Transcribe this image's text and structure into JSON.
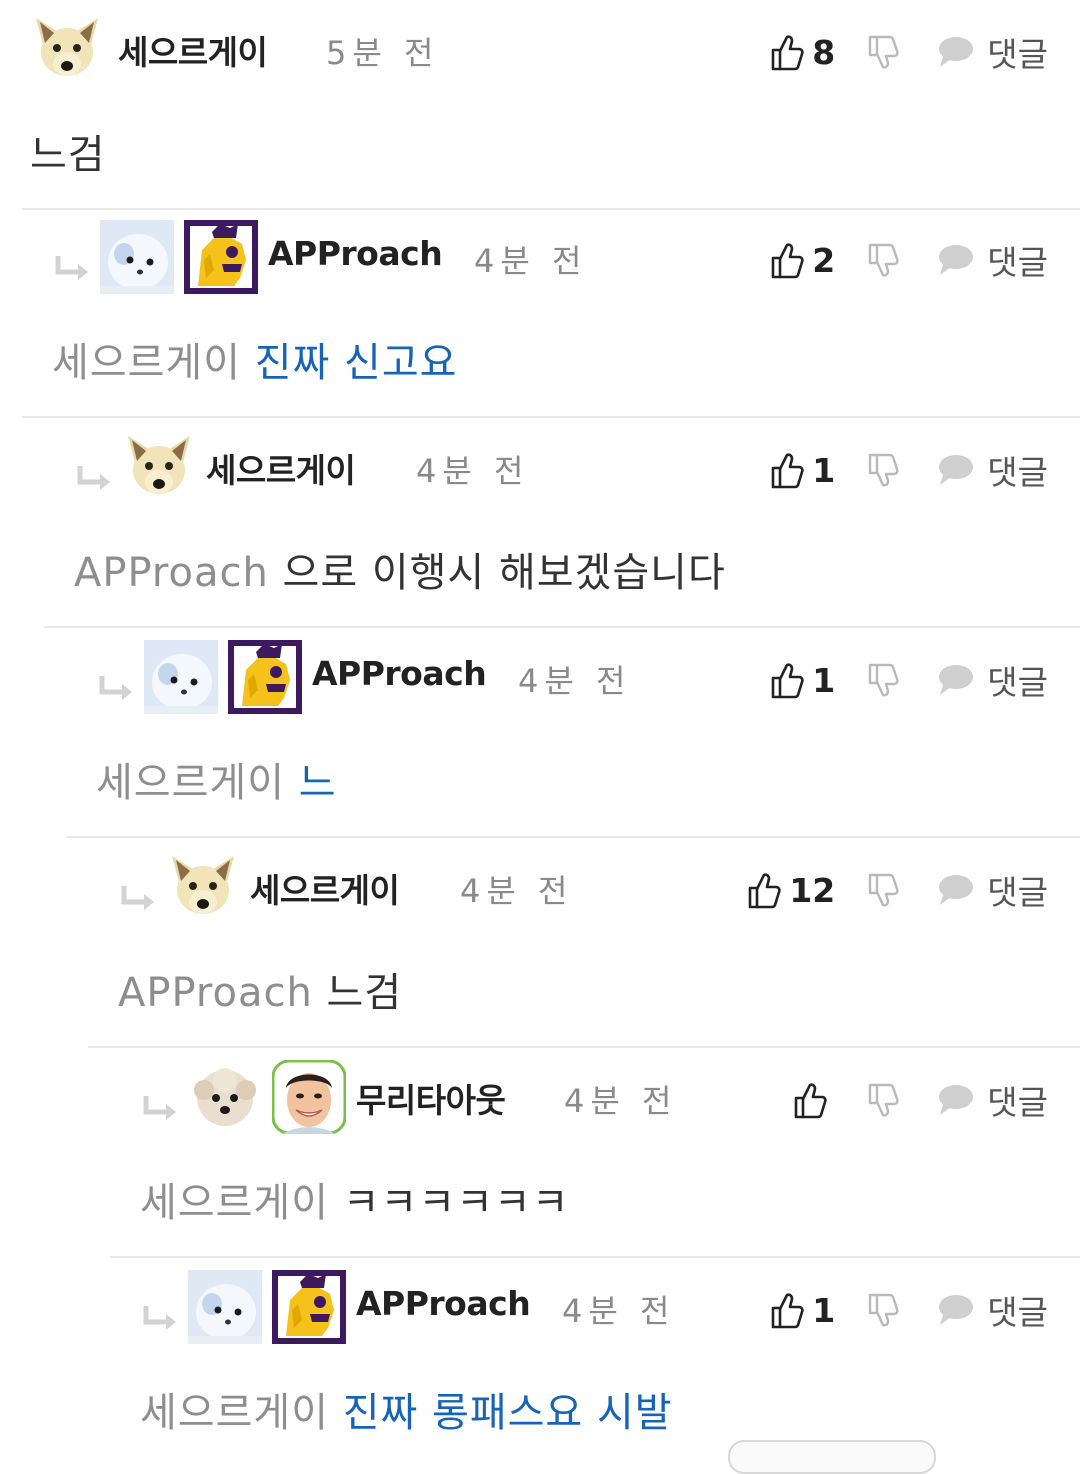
{
  "reply_label": "댓글",
  "comments": [
    {
      "user": "세으르게이",
      "time": "5분 전",
      "likes": "8",
      "mention": "",
      "text": "느검",
      "avatar": "dog-avatar"
    },
    {
      "user": "APProach",
      "time": "4분 전",
      "likes": "2",
      "mention": "세으르게이",
      "text": "진짜 신고요",
      "avatar": "seal-avatar",
      "badge": "premier-league-badge"
    },
    {
      "user": "세으르게이",
      "time": "4분 전",
      "likes": "1",
      "mention": "APProach",
      "text": "으로 이행시 해보겠습니다",
      "avatar": "dog-avatar"
    },
    {
      "user": "APProach",
      "time": "4분 전",
      "likes": "1",
      "mention": "세으르게이",
      "text": "느",
      "avatar": "seal-avatar",
      "badge": "premier-league-badge"
    },
    {
      "user": "세으르게이",
      "time": "4분 전",
      "likes": "12",
      "mention": "APProach",
      "text": "느검",
      "avatar": "dog-avatar"
    },
    {
      "user": "무리타아웃",
      "time": "4분 전",
      "likes": "",
      "mention": "세으르게이",
      "text": "ㅋㅋㅋㅋㅋㅋ",
      "avatar": "poodle-avatar",
      "badge": "player-face-badge"
    },
    {
      "user": "APProach",
      "time": "4분 전",
      "likes": "1",
      "mention": "세으르게이",
      "text": "진짜 롱패스요 시발",
      "avatar": "seal-avatar",
      "badge": "premier-league-badge"
    }
  ]
}
